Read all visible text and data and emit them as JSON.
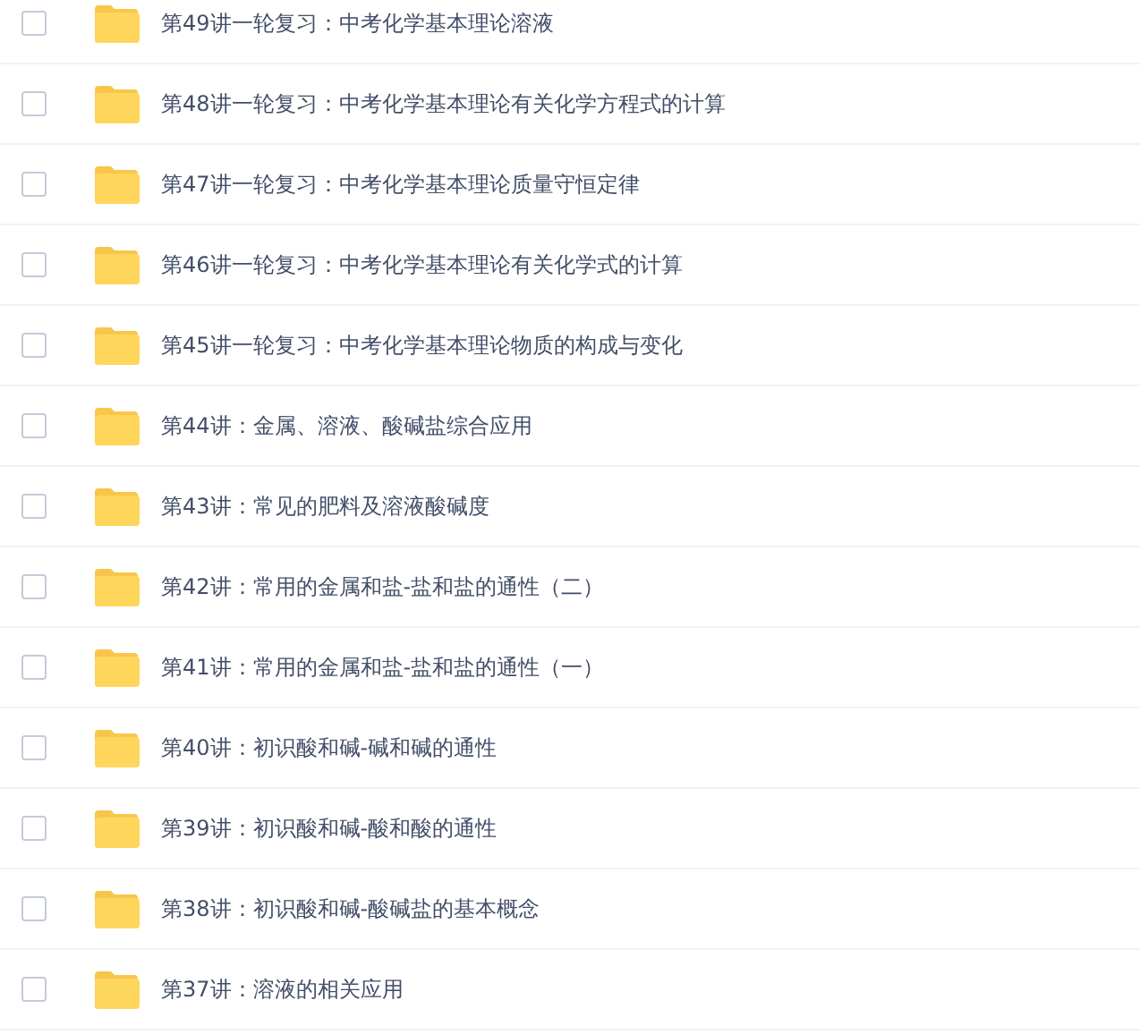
{
  "files": [
    {
      "name": "第49讲一轮复习：中考化学基本理论溶液",
      "checked": false
    },
    {
      "name": "第48讲一轮复习：中考化学基本理论有关化学方程式的计算",
      "checked": false
    },
    {
      "name": "第47讲一轮复习：中考化学基本理论质量守恒定律",
      "checked": false
    },
    {
      "name": "第46讲一轮复习：中考化学基本理论有关化学式的计算",
      "checked": false
    },
    {
      "name": "第45讲一轮复习：中考化学基本理论物质的构成与变化",
      "checked": false
    },
    {
      "name": "第44讲：金属、溶液、酸碱盐综合应用",
      "checked": false
    },
    {
      "name": "第43讲：常见的肥料及溶液酸碱度",
      "checked": false
    },
    {
      "name": "第42讲：常用的金属和盐-盐和盐的通性（二）",
      "checked": false
    },
    {
      "name": "第41讲：常用的金属和盐-盐和盐的通性（一）",
      "checked": false
    },
    {
      "name": "第40讲：初识酸和碱-碱和碱的通性",
      "checked": false
    },
    {
      "name": "第39讲：初识酸和碱-酸和酸的通性",
      "checked": false
    },
    {
      "name": "第38讲：初识酸和碱-酸碱盐的基本概念",
      "checked": false
    },
    {
      "name": "第37讲：溶液的相关应用",
      "checked": false
    }
  ]
}
